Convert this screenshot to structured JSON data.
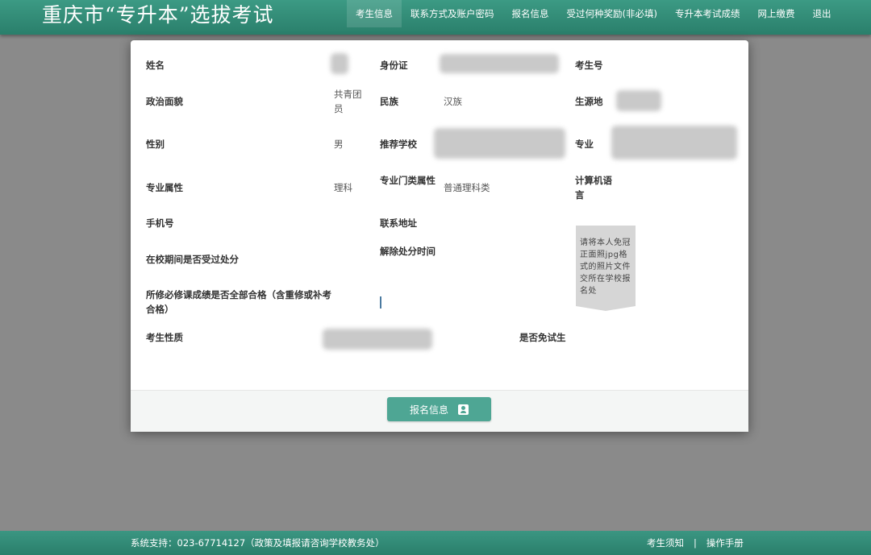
{
  "header": {
    "site_title": "重庆市“专升本”选拔考试",
    "nav": [
      {
        "label": "考生信息"
      },
      {
        "label": "联系方式及账户密码"
      },
      {
        "label": "报名信息"
      },
      {
        "label": "受过何种奖励(非必填)"
      },
      {
        "label": "专升本考试成绩"
      },
      {
        "label": "网上缴费"
      },
      {
        "label": "退出"
      }
    ],
    "active_index": 0
  },
  "form": {
    "name": {
      "label": "姓名",
      "value": ""
    },
    "id_card": {
      "label": "身份证",
      "value": ""
    },
    "exam_no": {
      "label": "考生号",
      "value": ""
    },
    "politics": {
      "label": "政治面貌",
      "value": "共青团员"
    },
    "ethnicity": {
      "label": "民族",
      "value": "汉族"
    },
    "origin": {
      "label": "生源地",
      "value": ""
    },
    "gender": {
      "label": "性别",
      "value": "男"
    },
    "school": {
      "label": "推荐学校",
      "value": ""
    },
    "major": {
      "label": "专业",
      "value": ""
    },
    "major_attr": {
      "label": "专业属性",
      "value": "理科"
    },
    "major_category": {
      "label": "专业门类属性",
      "value": "普通理科类"
    },
    "computer_lang": {
      "label": "计算机语言",
      "value": ""
    },
    "phone": {
      "label": "手机号",
      "value": ""
    },
    "address": {
      "label": "联系地址",
      "value": ""
    },
    "punished": {
      "label": "在校期间是否受过处分",
      "value": ""
    },
    "punish_release_time": {
      "label": "解除处分时间",
      "value": ""
    },
    "required_courses_passed": {
      "label": "所修必修课成绩是否全部合格（含重修或补考合格）",
      "value": ""
    },
    "candidate_type": {
      "label": "考生性质",
      "value": ""
    },
    "exempt": {
      "label": "是否免试生",
      "value": ""
    }
  },
  "photo": {
    "notice": "请将本人免冠正面照jpg格式的照片文件交所在学校报名处"
  },
  "action_button": {
    "label": "报名信息",
    "icon": "id-card-icon"
  },
  "footer": {
    "support": "系统支持：023-67714127（政策及填报请咨询学校教务处）",
    "links": [
      "考生须知",
      "操作手册"
    ],
    "separator": "|"
  },
  "colors": {
    "brand_green": "#2e8873",
    "button_green": "#4ea694",
    "overlay_gray": "#8a8a8a"
  }
}
